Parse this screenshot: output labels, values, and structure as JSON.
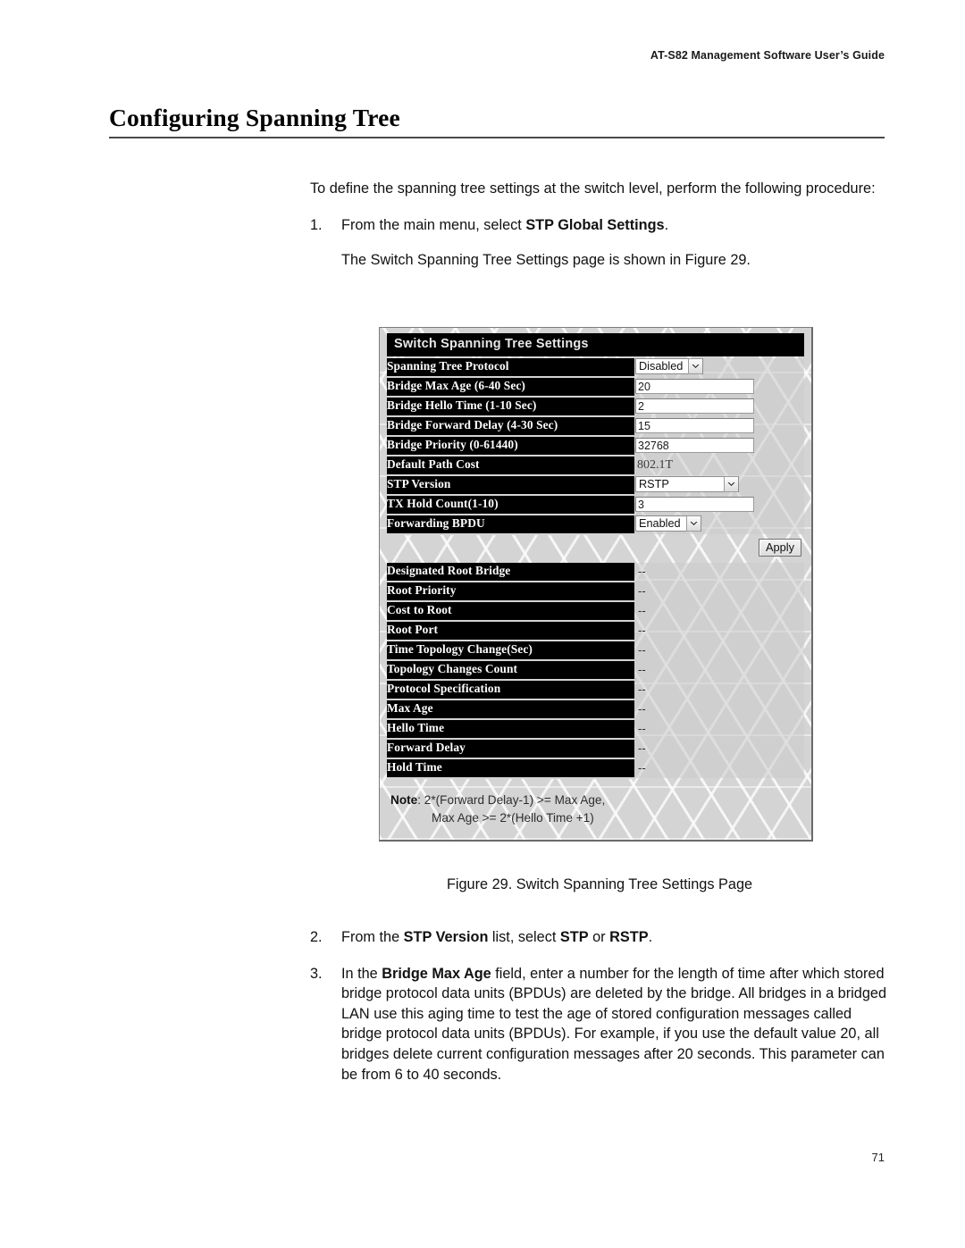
{
  "header": {
    "running_title": "AT-S82 Management Software User’s Guide"
  },
  "page": {
    "chapter_title": "Configuring Spanning Tree",
    "page_number": "71"
  },
  "intro": {
    "paragraph": "To define the spanning tree settings at the switch level, perform the following procedure:"
  },
  "steps": [
    {
      "number": "1.",
      "text_before": "From the main menu, select ",
      "bold": "STP Global Settings",
      "text_after": ".",
      "continuation": "The Switch Spanning Tree Settings page is shown in Figure 29."
    },
    {
      "number": "2.",
      "text_before": "From the ",
      "bold": "STP Version",
      "text_mid": " list, select ",
      "bold2": "STP",
      "text_mid2": " or ",
      "bold3": "RSTP",
      "text_after": "."
    },
    {
      "number": "3.",
      "text_before": "In the ",
      "bold": "Bridge Max Age",
      "text_after": " field, enter a number for the length of time after which stored bridge protocol data units (BPDUs) are deleted by the bridge. All bridges in a bridged LAN use this aging time to test the age of stored configuration messages called bridge protocol data units (BPDUs). For example, if you use the default value 20, all bridges delete current configuration messages after 20 seconds. This parameter can be from 6 to 40 seconds."
    }
  ],
  "figure": {
    "caption": "Figure 29. Switch Spanning Tree Settings Page",
    "panel_title": "Switch Spanning Tree Settings",
    "settings_rows": [
      {
        "label": "Spanning Tree Protocol",
        "control": "select",
        "value": "Disabled",
        "width": "w-sm"
      },
      {
        "label": "Bridge Max Age (6-40 Sec)",
        "control": "text",
        "value": "20"
      },
      {
        "label": "Bridge Hello Time (1-10 Sec)",
        "control": "text",
        "value": "2"
      },
      {
        "label": "Bridge Forward Delay (4-30 Sec)",
        "control": "text",
        "value": "15"
      },
      {
        "label": "Bridge Priority (0-61440)",
        "control": "text",
        "value": "32768"
      },
      {
        "label": "Default Path Cost",
        "control": "plain",
        "value": "802.1T"
      },
      {
        "label": "STP Version",
        "control": "select",
        "value": "RSTP",
        "width": "w-lg"
      },
      {
        "label": "TX Hold Count(1-10)",
        "control": "text",
        "value": "3"
      },
      {
        "label": "Forwarding BPDU",
        "control": "select",
        "value": "Enabled",
        "width": "w-md"
      }
    ],
    "apply_label": "Apply",
    "status_rows": [
      {
        "label": "Designated Root Bridge",
        "value": "--"
      },
      {
        "label": "Root Priority",
        "value": "--"
      },
      {
        "label": "Cost to Root",
        "value": "--"
      },
      {
        "label": "Root Port",
        "value": "--"
      },
      {
        "label": "Time Topology Change(Sec)",
        "value": "--"
      },
      {
        "label": "Topology Changes Count",
        "value": "--"
      },
      {
        "label": "Protocol Specification",
        "value": "--"
      },
      {
        "label": "Max Age",
        "value": "--"
      },
      {
        "label": "Hello Time",
        "value": "--"
      },
      {
        "label": "Forward Delay",
        "value": "--"
      },
      {
        "label": "Hold Time",
        "value": "--"
      }
    ],
    "note": {
      "label": "Note",
      "line1": ": 2*(Forward Delay-1) >= Max Age,",
      "line2": "Max Age >= 2*(Hello Time +1)"
    }
  },
  "colors": {
    "panel_bg": "#000000",
    "panel_text": "#e8e8e8",
    "figure_bg": "#d4d4d4",
    "frame_border": "#7c7c7c"
  }
}
